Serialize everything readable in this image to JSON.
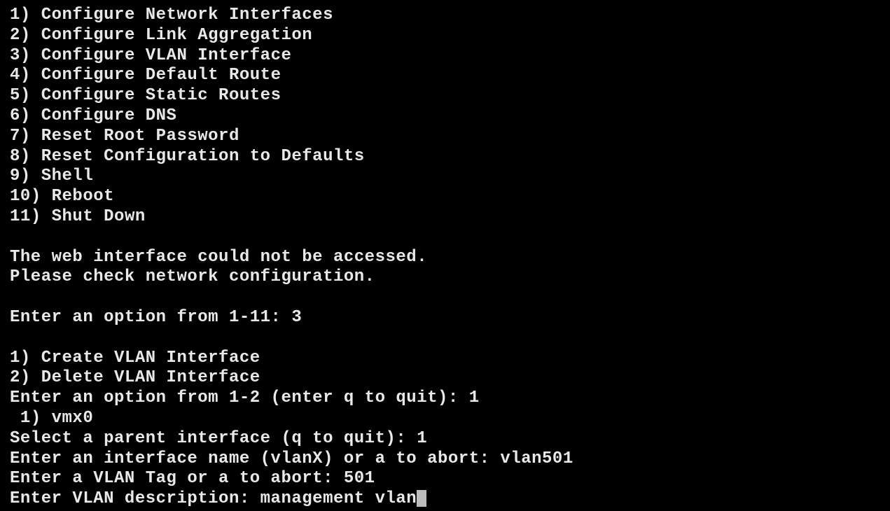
{
  "main_menu": {
    "items": [
      {
        "num": "1",
        "label": "Configure Network Interfaces"
      },
      {
        "num": "2",
        "label": "Configure Link Aggregation"
      },
      {
        "num": "3",
        "label": "Configure VLAN Interface"
      },
      {
        "num": "4",
        "label": "Configure Default Route"
      },
      {
        "num": "5",
        "label": "Configure Static Routes"
      },
      {
        "num": "6",
        "label": "Configure DNS"
      },
      {
        "num": "7",
        "label": "Reset Root Password"
      },
      {
        "num": "8",
        "label": "Reset Configuration to Defaults"
      },
      {
        "num": "9",
        "label": "Shell"
      },
      {
        "num": "10",
        "label": "Reboot"
      },
      {
        "num": "11",
        "label": "Shut Down"
      }
    ]
  },
  "status": {
    "line1": "The web interface could not be accessed.",
    "line2": "Please check network configuration."
  },
  "main_prompt": {
    "text": "Enter an option from 1-11: ",
    "value": "3"
  },
  "vlan_menu": {
    "items": [
      {
        "num": "1",
        "label": "Create VLAN Interface"
      },
      {
        "num": "2",
        "label": "Delete VLAN Interface"
      }
    ]
  },
  "vlan_prompt": {
    "text": "Enter an option from 1-2 (enter q to quit): ",
    "value": "1"
  },
  "iface_list": {
    "items": [
      {
        "num": "1",
        "label": "vmx0"
      }
    ]
  },
  "parent_prompt": {
    "text": "Select a parent interface (q to quit): ",
    "value": "1"
  },
  "name_prompt": {
    "text": "Enter an interface name (vlanX) or a to abort: ",
    "value": "vlan501"
  },
  "tag_prompt": {
    "text": "Enter a VLAN Tag or a to abort: ",
    "value": "501"
  },
  "desc_prompt": {
    "text": "Enter VLAN description: ",
    "value": "management vlan"
  }
}
